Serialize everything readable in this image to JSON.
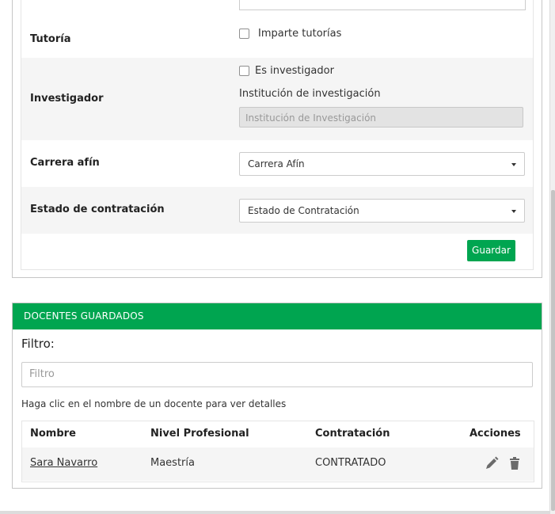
{
  "form": {
    "tutoria": {
      "label": "Tutoría",
      "checkbox_label": "Imparte tutorías"
    },
    "investigador": {
      "label": "Investigador",
      "checkbox_label": "Es investigador",
      "institution_label": "Institución de investigación",
      "institution_placeholder": "Institución de Investigación"
    },
    "carrera": {
      "label": "Carrera afín",
      "selected": "Carrera Afín"
    },
    "estado": {
      "label": "Estado de contratación",
      "selected": "Estado de Contratación"
    },
    "save_label": "Guardar"
  },
  "saved_list": {
    "header": "DOCENTES GUARDADOS",
    "filter_label": "Filtro:",
    "filter_placeholder": "Filtro",
    "hint": "Haga clic en el nombre de un docente para ver detalles",
    "columns": [
      "Nombre",
      "Nivel Profesional",
      "Contratación",
      "Acciones"
    ],
    "rows": [
      {
        "nombre": "Sara Navarro",
        "nivel": "Maestría",
        "contratacion": "CONTRATADO",
        "actions": [
          "pencil-icon",
          "trash-icon"
        ]
      }
    ]
  },
  "colors": {
    "accent": "#00a550",
    "row_alt": "#f5f5f5"
  }
}
